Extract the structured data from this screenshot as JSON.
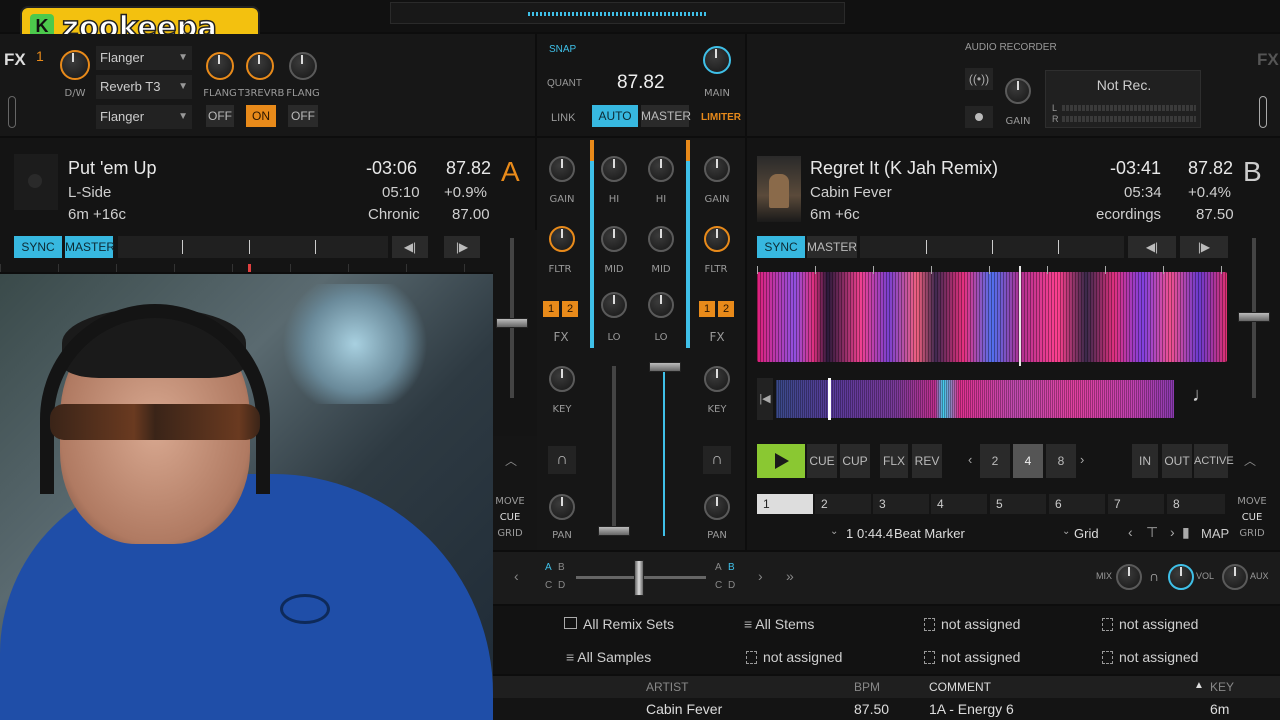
{
  "logo": {
    "text": "zookeepa",
    "badge": "K"
  },
  "top_bar": {
    "mid_label": ""
  },
  "fx_left": {
    "fx_label": "FX",
    "unit": "1",
    "dw_label": "D/W",
    "slots": [
      "Flanger",
      "Reverb T3",
      "Flanger"
    ],
    "knob_labels": [
      "FLANG",
      "T3REVRB",
      "FLANG"
    ],
    "toggles": [
      "OFF",
      "ON",
      "OFF"
    ]
  },
  "master": {
    "snap": "SNAP",
    "quant": "QUANT",
    "bpm": "87.82",
    "link": "LINK",
    "auto": "AUTO",
    "master": "MASTER",
    "main": "MAIN",
    "limiter": "LIMITER"
  },
  "recorder": {
    "title": "AUDIO RECORDER",
    "status": "Not Rec.",
    "gain": "GAIN",
    "l": "L",
    "r": "R",
    "fx_label": "FX"
  },
  "deck_a": {
    "letter": "A",
    "title": "Put 'em Up",
    "artist": "L-Side",
    "key": "6m +16c",
    "remaining": "-03:06",
    "length": "05:10",
    "album": "Chronic",
    "bpm": "87.82",
    "pitch": "+0.9%",
    "orig_bpm": "87.00",
    "sync": "SYNC",
    "master": "MASTER"
  },
  "deck_b": {
    "letter": "B",
    "title": "Regret It (K Jah Remix)",
    "artist": "Cabin Fever",
    "key": "6m +6c",
    "remaining": "-03:41",
    "length": "05:34",
    "album": "ecordings",
    "bpm": "87.82",
    "pitch": "+0.4%",
    "orig_bpm": "87.50",
    "sync": "SYNC",
    "master": "MASTER",
    "transport": {
      "cue": "CUE",
      "cup": "CUP",
      "flx": "FLX",
      "rev": "REV",
      "loops": [
        "2",
        "4",
        "8"
      ],
      "in": "IN",
      "out": "OUT",
      "active": "ACTIVE"
    },
    "cue_slots": [
      "1",
      "2",
      "3",
      "4",
      "5",
      "6",
      "7",
      "8"
    ],
    "cue_info": {
      "num": "1",
      "time": "0:44.4",
      "name": "Beat Marker",
      "type": "Grid",
      "map": "MAP"
    }
  },
  "mixer": {
    "left": {
      "gain": "GAIN",
      "fltr": "FLTR",
      "fx": "FX",
      "key": "KEY",
      "pan": "PAN",
      "fx_buttons": [
        "1",
        "2"
      ]
    },
    "eq_left": [
      "HI",
      "MID",
      "LO"
    ],
    "eq_right": [
      "HI",
      "MID",
      "LO"
    ],
    "right": {
      "gain": "GAIN",
      "fltr": "FLTR",
      "fx": "FX",
      "key": "KEY",
      "pan": "PAN",
      "fx_buttons": [
        "1",
        "2"
      ]
    },
    "move": "MOVE",
    "cue": "CUE",
    "grid": "GRID"
  },
  "crossfader": {
    "assign_left": [
      "A",
      "B",
      "C",
      "D"
    ],
    "assign_right": [
      "A",
      "B",
      "C",
      "D"
    ],
    "mix": "MIX",
    "vol": "VOL",
    "aux": "AUX"
  },
  "browser": {
    "favorites": [
      [
        "All Remix Sets",
        "All Stems",
        "not assigned",
        "not assigned"
      ],
      [
        "All Samples",
        "not assigned",
        "not assigned",
        "not assigned"
      ]
    ],
    "columns": [
      "ARTIST",
      "BPM",
      "COMMENT",
      "KEY"
    ],
    "row": {
      "artist": "Cabin Fever",
      "bpm": "87.50",
      "comment": "1A - Energy 6",
      "key": "6m"
    }
  }
}
